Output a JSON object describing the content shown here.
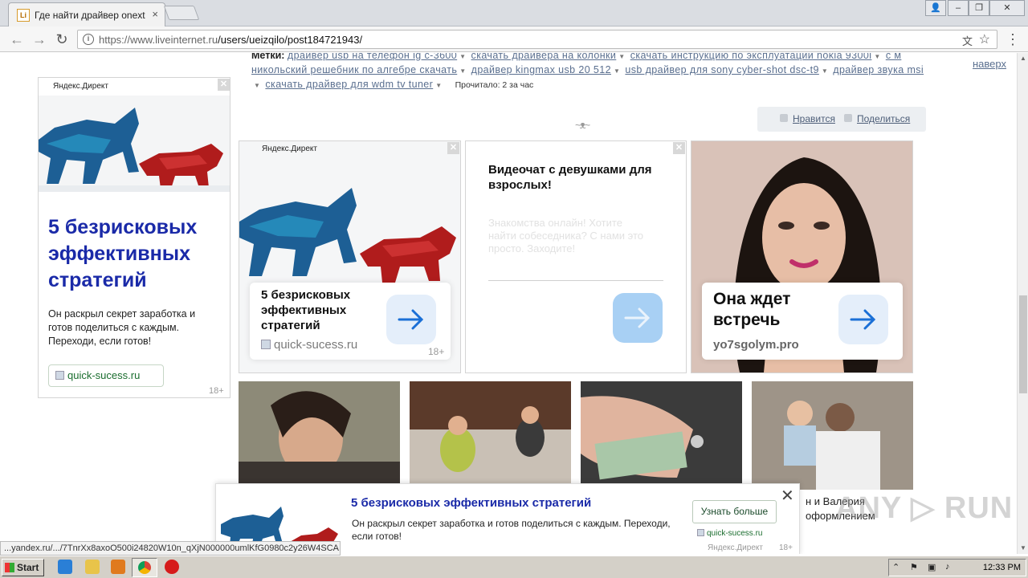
{
  "browser": {
    "tab_title": "Где найти драйвер onext",
    "tab_favicon": "Li",
    "url_host": "https://www.liveinternet.ru",
    "url_path": "/users/ueizqilo/post184721943/"
  },
  "tags": {
    "label": "Метки:",
    "items": [
      "драйвер usb на телефон lg c-3600",
      "скачать драйвера на колонки",
      "скачать инструкцию по эксплуатации nokia 9300i",
      "с м никольский решебник по алгебре скачать",
      "драйвер kingmax usb 20 512",
      "usb драйвер для sony cyber-shot dsc-t9",
      "драйвер звука msi",
      "скачать драйвер для wdm tv tuner"
    ],
    "read_text": "Прочитало: 2 за час",
    "to_top": "наверх"
  },
  "likebar": {
    "like": "Нравится",
    "share": "Поделиться"
  },
  "ad_left": {
    "brand": "Яндекс.Директ",
    "headline": "5 безрисковых эффективных стратегий",
    "body": "Он раскрыл секрет заработка и готов поделиться с каждым. Переходи, если готов!",
    "site": "quick-sucess.ru",
    "age": "18+"
  },
  "ad_card1": {
    "brand": "Яндекс.Директ",
    "headline": "5 безрисковых эффективных стратегий",
    "site": "quick-sucess.ru",
    "age": "18+"
  },
  "ad_card2": {
    "headline": "Видеочат с девушками для взрослых!",
    "body": "Знакомства онлайн! Хотите найти собеседника? С нами это просто. Заходите!"
  },
  "ad_card3": {
    "headline": "Она ждет встречь",
    "site": "yo7sgolym.pro"
  },
  "thumb_caption": "н и Валерия\nоформлением",
  "banner": {
    "headline": "5 безрисковых эффективных стратегий",
    "body": "Он раскрыл секрет заработка и готов поделиться с каждым. Переходи, если готов!",
    "button": "Узнать больше",
    "site": "quick-sucess.ru",
    "brand": "Яндекс.Директ",
    "age": "18+"
  },
  "status_url": "...yandex.ru/.../7TnrXx8axoO500i24820W10n_qXjN000000umlKfG0980c2y26W4SCA...",
  "taskbar": {
    "start": "Start",
    "clock": "12:33 PM"
  },
  "colors": {
    "ad_blue": "#1a2aa8",
    "link": "#5a6f8f",
    "arrow_blue": "#1a6fd6"
  }
}
